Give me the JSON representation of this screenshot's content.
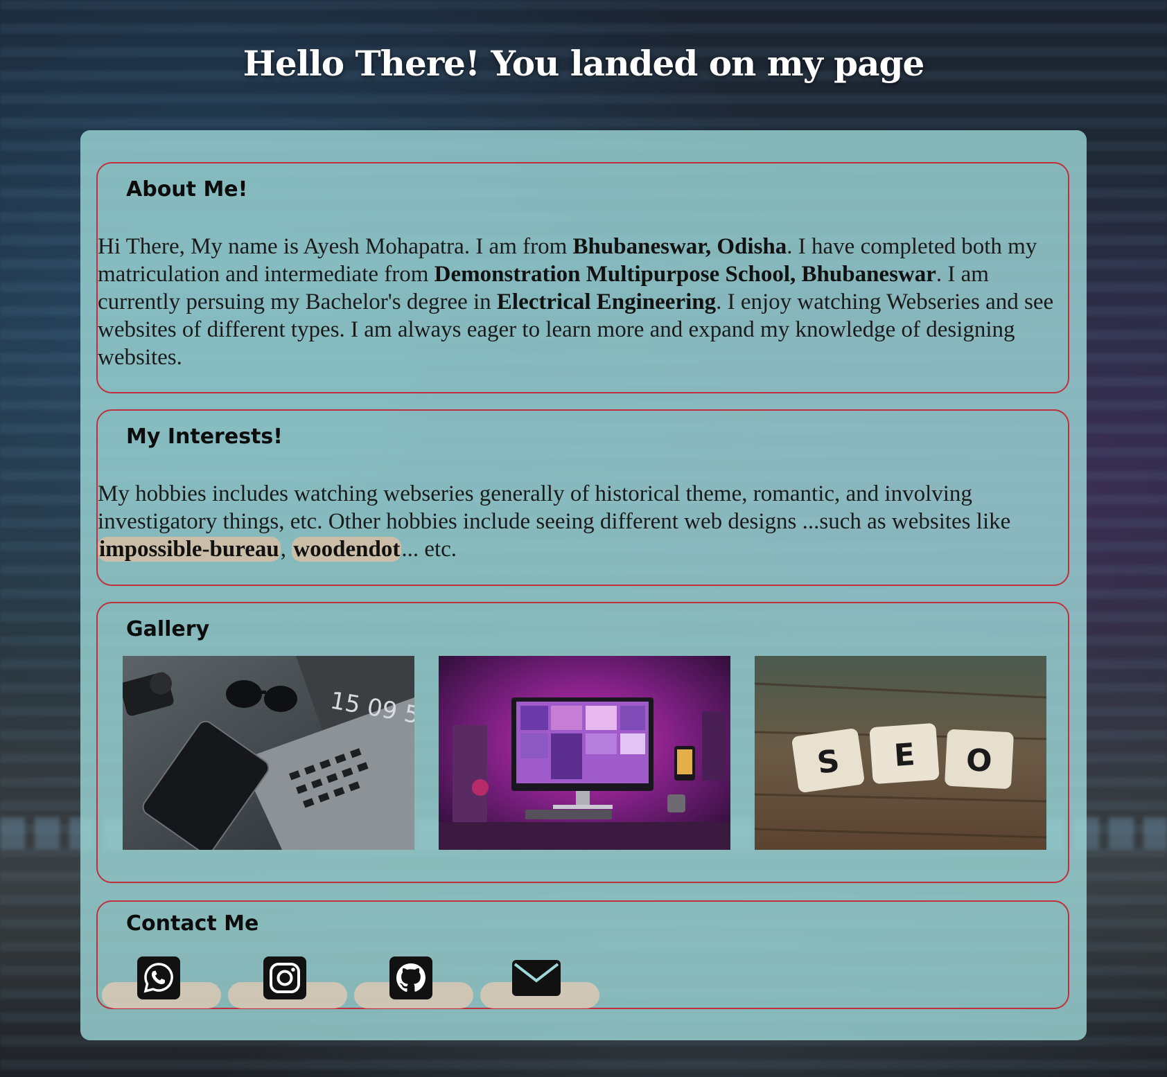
{
  "page": {
    "title": "Hello There! You landed on my page"
  },
  "about": {
    "heading": "About Me!",
    "p1": "Hi There, My name is Ayesh Mohapatra. I am from ",
    "b1": "Bhubaneswar, Odisha",
    "p2": ". I have completed both my matriculation and intermediate from ",
    "b2": "Demonstration Multipurpose School, Bhubaneswar",
    "p3": ". I am currently persuing my Bachelor's degree in ",
    "b3": "Electrical Engineering",
    "p4": ". I enjoy watching Webseries and see websites of different types. I am always eager to learn more and expand my knowledge of designing websites."
  },
  "interests": {
    "heading": "My Interests!",
    "p1": "My hobbies includes watching webseries generally of historical theme, romantic, and involving investigatory things, etc. Other hobbies include seeing different web designs ...such as websites like ",
    "link1": "impossible-bureau",
    "sep": ", ",
    "link2": "woodendot",
    "p2": "... etc."
  },
  "gallery": {
    "heading": "Gallery",
    "images": [
      {
        "name": "laptop-desk-photo",
        "overlay_text": "15 09 5"
      },
      {
        "name": "neon-computer-setup-photo"
      },
      {
        "name": "seo-tiles-photo",
        "tiles": [
          "S",
          "E",
          "O"
        ]
      }
    ]
  },
  "contact": {
    "heading": "Contact Me",
    "links": [
      {
        "icon": "whatsapp-icon"
      },
      {
        "icon": "instagram-icon"
      },
      {
        "icon": "github-icon"
      },
      {
        "icon": "email-icon"
      }
    ]
  },
  "colors": {
    "card_bg": "#9ed8d8",
    "section_border": "#c0303a",
    "link_highlight": "#d7bea5",
    "title_text": "#ffffff"
  }
}
